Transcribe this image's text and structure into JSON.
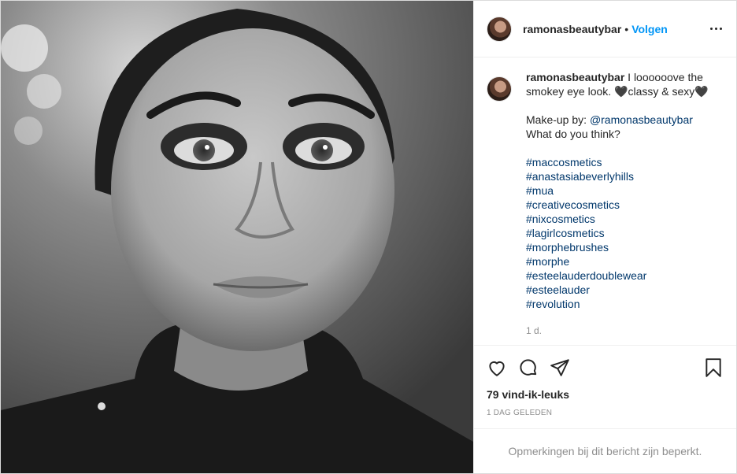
{
  "post": {
    "username": "ramonasbeautybar",
    "dot": "•",
    "follow_label": "Volgen",
    "caption_text": " I loooooove the smokey eye look. 🖤classy & sexy🖤",
    "makeup_by_label": "Make-up by: ",
    "makeup_mention": "@ramonasbeautybar",
    "question": "What do you think?",
    "hashtags": [
      "#maccosmetics",
      "#anastasiabeverlyhills",
      "#mua",
      "#creativecosmetics",
      "#nixcosmetics",
      "#lagirlcosmetics",
      "#morphebrushes",
      "#morphe",
      "#esteelauderdoublewear",
      "#esteelauder",
      "#revolution"
    ],
    "comment_time": "1 d.",
    "likes": "79 vind-ik-leuks",
    "posted_ago": "1 DAG GELEDEN",
    "comments_limited": "Opmerkingen bij dit bericht zijn beperkt."
  },
  "icons": {
    "like": "heart-icon",
    "comment": "comment-icon",
    "share": "paper-plane-icon",
    "save": "bookmark-icon",
    "more": "more-options-icon"
  },
  "colors": {
    "accent": "#0095f6",
    "link": "#00376b",
    "muted": "#8e8e8e",
    "text": "#262626",
    "border": "#efefef"
  }
}
